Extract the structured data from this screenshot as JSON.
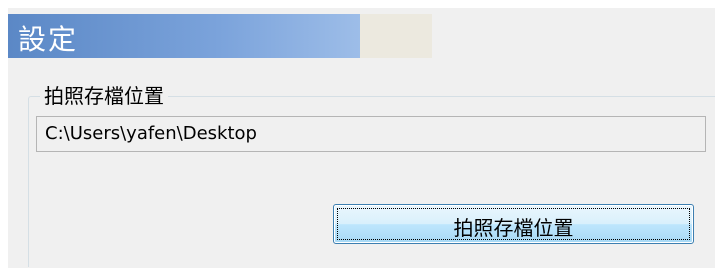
{
  "dialog": {
    "title": "設定"
  },
  "photo_location_group": {
    "legend": "拍照存檔位置",
    "path_value": "C:\\Users\\yafen\\Desktop",
    "button_label": "拍照存檔位置"
  },
  "colors": {
    "title_bar_accent": "#5b88c6",
    "dialog_background": "#f0f0f0",
    "button_border": "#3c7fb1"
  }
}
